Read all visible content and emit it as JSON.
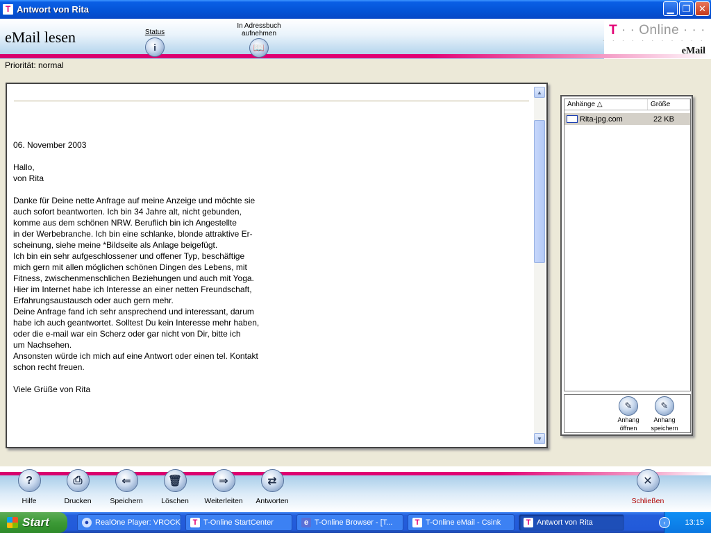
{
  "window": {
    "title": "Antwort von Rita"
  },
  "header": {
    "page_title": "eMail lesen",
    "status_label": "Status",
    "addressbook_label_1": "In Adressbuch",
    "addressbook_label_2": "aufnehmen",
    "logo_brand": "T",
    "logo_dots": "· ·",
    "logo_online": "Online",
    "logo_trailing_dots": "· · ·",
    "logo_dotline": "· · · · · · · · · · ·",
    "logo_email": "eMail"
  },
  "priority": "Priorität: normal",
  "message": {
    "paragraphs": [
      "06. November 2003",
      "Hallo,\nvon Rita",
      "Danke für Deine nette Anfrage auf meine Anzeige und möchte sie\nauch sofort beantworten. Ich bin 34 Jahre alt, nicht gebunden,\nkomme aus dem schönen NRW. Beruflich bin ich Angestellte\nin der Werbebranche. Ich bin eine schlanke, blonde attraktive Er-\nscheinung, siehe meine *Bildseite als Anlage beigefügt.\nIch bin ein sehr aufgeschlossener und offener Typ, beschäftige\nmich gern mit allen möglichen schönen Dingen des Lebens, mit\nFitness, zwischenmenschlichen Beziehungen und auch mit Yoga.\nHier im Internet habe ich Interesse an einer netten Freundschaft,\nErfahrungsaustausch oder auch gern mehr.\nDeine Anfrage fand ich sehr ansprechend und interessant, darum\nhabe ich auch geantwortet. Solltest Du kein Interesse mehr haben,\noder die e-mail war ein Scherz oder gar nicht von Dir, bitte ich\num Nachsehen.\nAnsonsten würde ich mich auf eine Antwort oder einen tel. Kontakt\nschon recht freuen.",
      "Viele Grüße von Rita"
    ]
  },
  "attachments": {
    "col_name": "Anhänge △",
    "col_size": "Größe",
    "items": [
      {
        "name": "Rita-jpg.com",
        "size": "22 KB"
      }
    ],
    "open_label_1": "Anhang",
    "open_label_2": "öffnen",
    "save_label_1": "Anhang",
    "save_label_2": "speichern"
  },
  "toolbar": {
    "help": "Hilfe",
    "print": "Drucken",
    "save": "Speichern",
    "delete": "Löschen",
    "forward": "Weiterleiten",
    "reply": "Antworten",
    "close": "Schließen"
  },
  "taskbar": {
    "start": "Start",
    "tasks": [
      "RealOne Player: VROCK",
      "T-Online StartCenter",
      "T-Online Browser - [T...",
      "T-Online eMail - Csink",
      "Antwort von Rita"
    ],
    "clock": "13:15"
  },
  "colors": {
    "brand_magenta": "#e20074",
    "xp_blue": "#245edb"
  }
}
